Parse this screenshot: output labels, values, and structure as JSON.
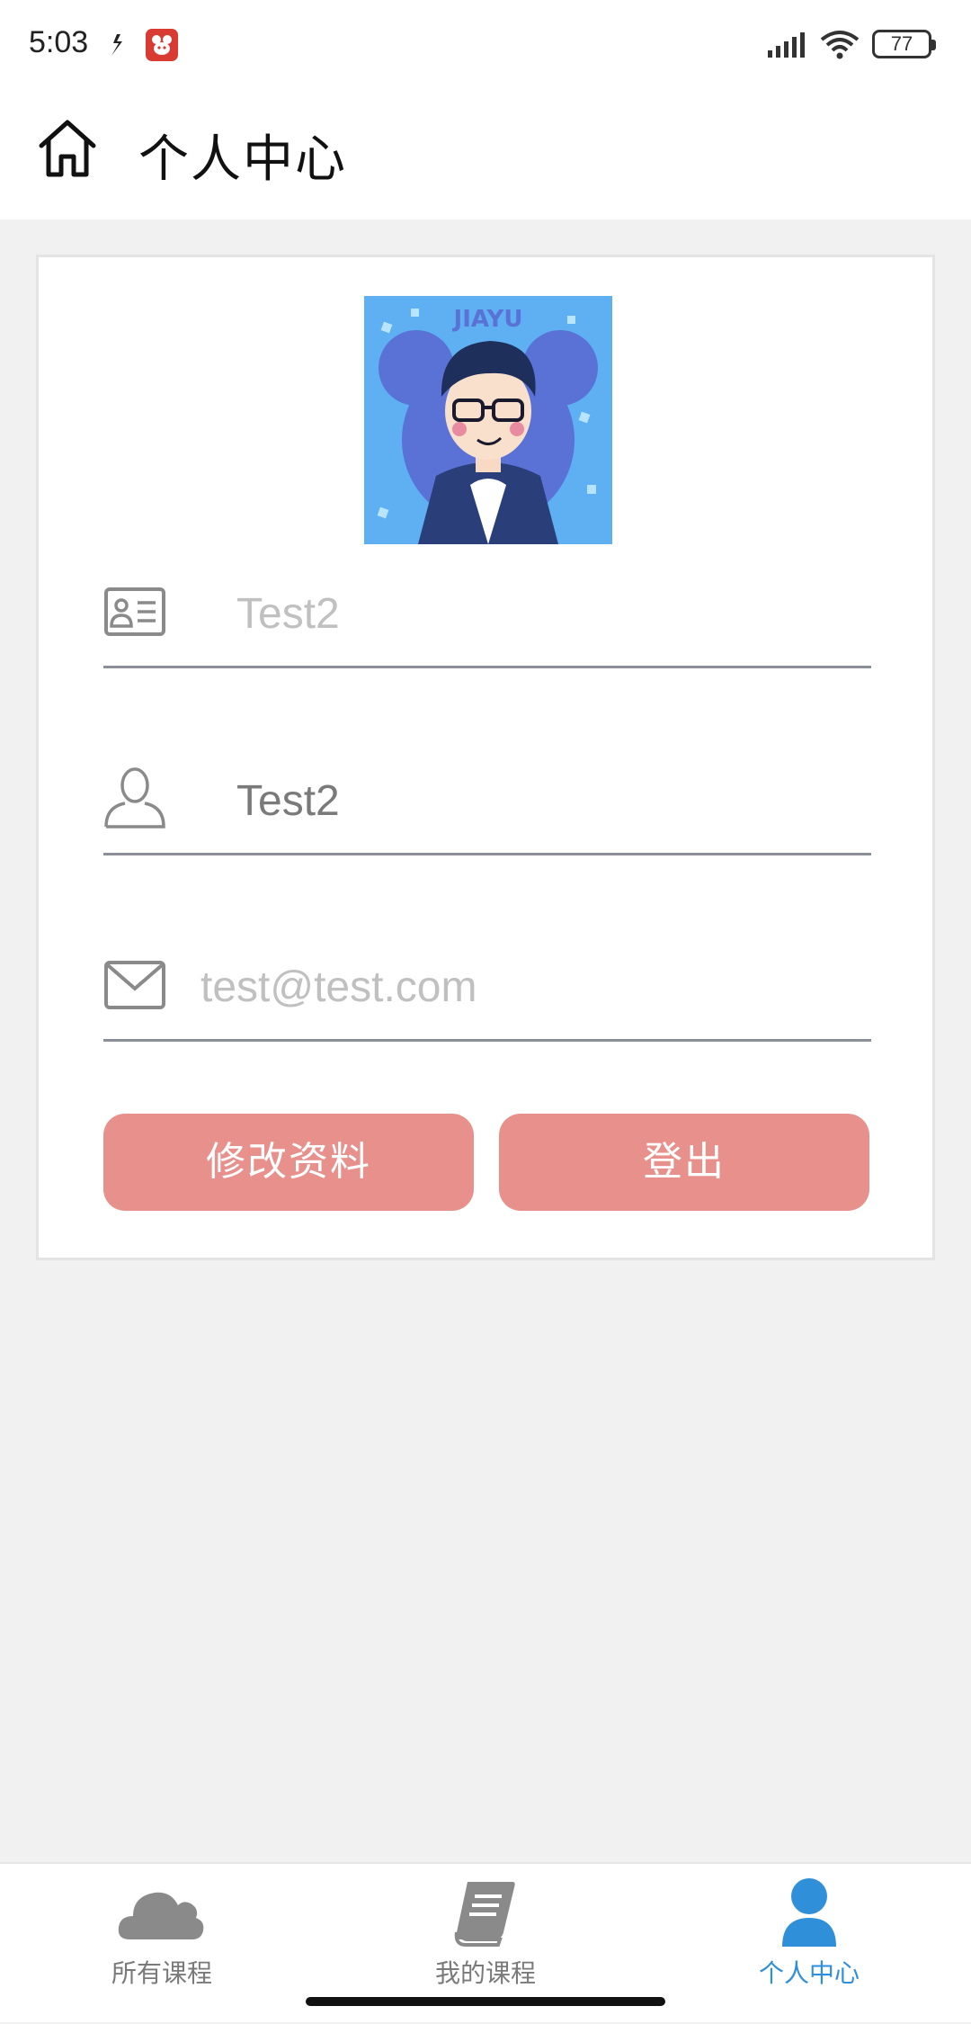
{
  "status_bar": {
    "time": "5:03",
    "battery": "77",
    "icons": [
      "notification-app-icon",
      "notification-app2-icon",
      "signal-icon",
      "wifi-icon",
      "battery-icon"
    ]
  },
  "header": {
    "title": "个人中心",
    "icon": "home-icon"
  },
  "profile": {
    "avatar_text": "JIAYU",
    "fields": [
      {
        "icon": "id-card-icon",
        "value": "Test2"
      },
      {
        "icon": "user-icon",
        "value": "Test2"
      },
      {
        "icon": "envelope-icon",
        "value": "test@test.com"
      }
    ],
    "buttons": {
      "edit_label": "修改资料",
      "logout_label": "登出"
    }
  },
  "bottom_nav": {
    "items": [
      {
        "label": "所有课程",
        "icon": "cloud-icon",
        "active": false
      },
      {
        "label": "我的课程",
        "icon": "book-icon",
        "active": false
      },
      {
        "label": "个人中心",
        "icon": "person-icon",
        "active": true
      }
    ]
  },
  "colors": {
    "button": "#e8918c",
    "nav_active": "#2f8fd8",
    "nav_inactive": "#8a8a8a",
    "background": "#f1f1f1"
  }
}
